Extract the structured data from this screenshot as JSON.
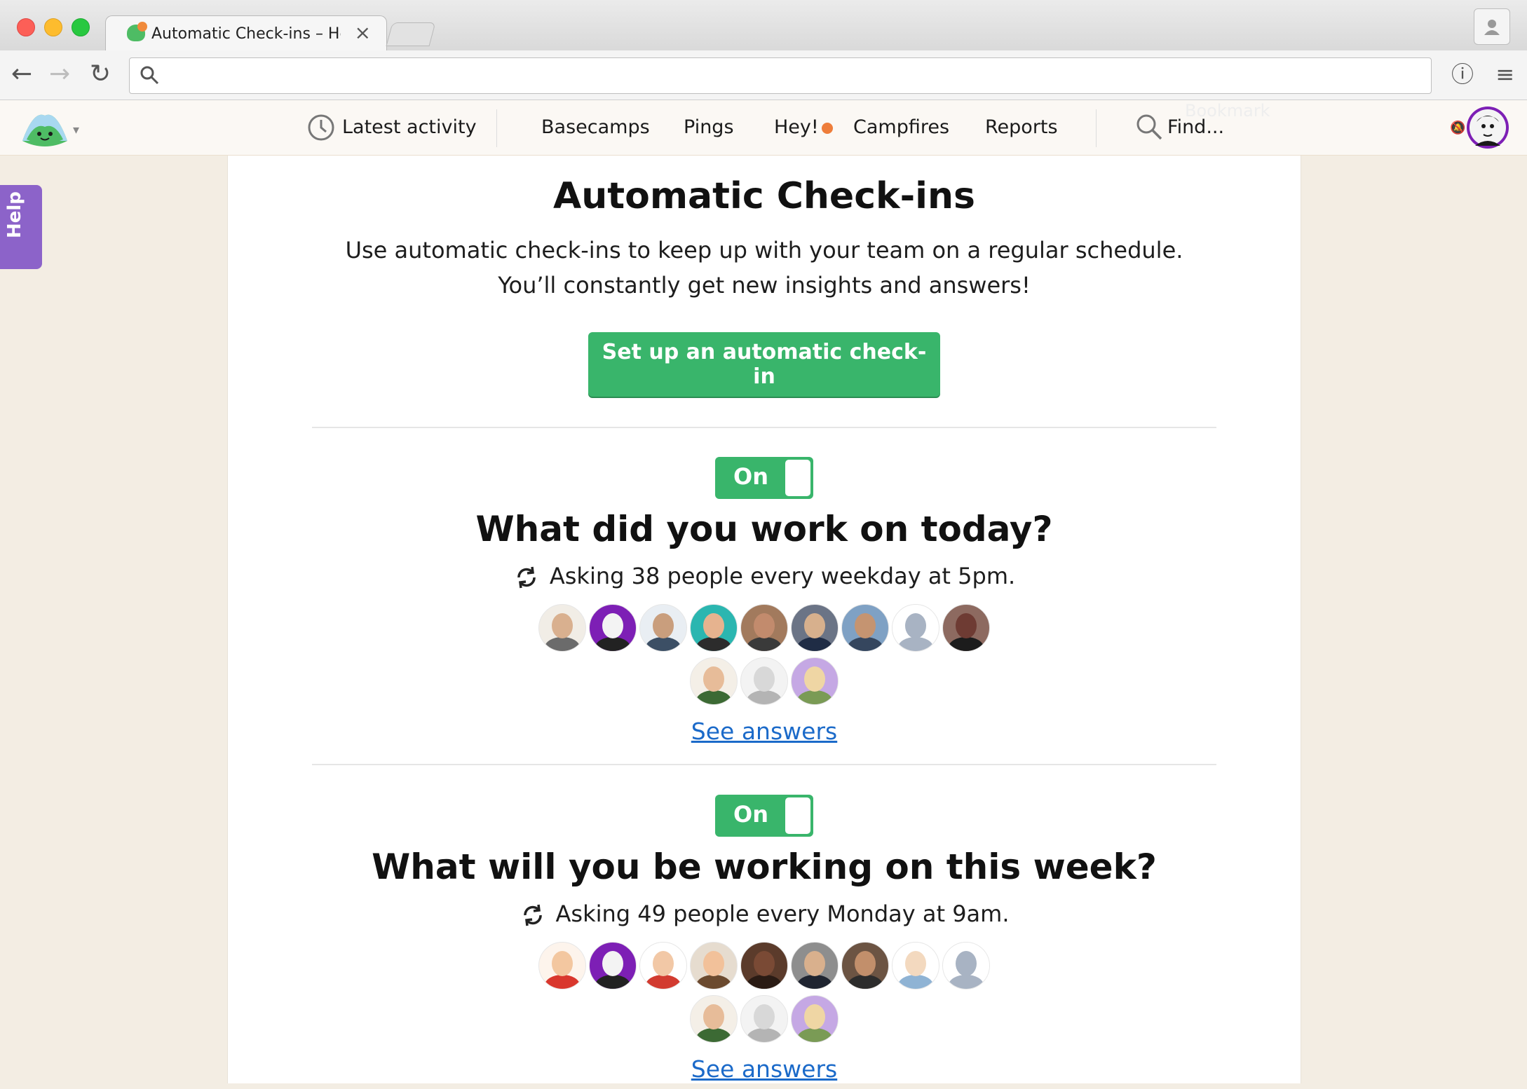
{
  "browser": {
    "tab_title": "Automatic Check-ins – Hea",
    "tab_close": "×",
    "address": ""
  },
  "app_nav": {
    "latest_activity": "Latest activity",
    "basecamps": "Basecamps",
    "pings": "Pings",
    "hey": "Hey!",
    "campfires": "Campfires",
    "reports": "Reports",
    "find": "Find...",
    "ghost_hint": "Bookmark",
    "hey_dot_color": "#ee7d3a"
  },
  "help": {
    "label": "Help"
  },
  "page": {
    "title": "Automatic Check-ins",
    "intro": "Use automatic check-ins to keep up with your team on a regular schedule. You’ll constantly get new insights and answers!",
    "cta": "Set up an automatic check-in"
  },
  "questions": [
    {
      "toggle": "On",
      "title": "What did you work on today?",
      "schedule": "Asking 38 people every weekday at 5pm.",
      "see_answers": "See answers",
      "avatars_row1": [
        {
          "face": "#d9b08f",
          "body": "#6b6b6b",
          "bg": "#f1ede6"
        },
        {
          "face": "#f3f3f3",
          "body": "#222",
          "bg": "#7d1fb5"
        },
        {
          "face": "#c99e7d",
          "body": "#3c4f65",
          "bg": "#e9eef3"
        },
        {
          "face": "#e6b38f",
          "body": "#2c2c2c",
          "bg": "#2bb6b0"
        },
        {
          "face": "#c28b6d",
          "body": "#3a3a3a",
          "bg": "#a27a5d"
        },
        {
          "face": "#d7b08d",
          "body": "#1f2c45",
          "bg": "#6b7486"
        },
        {
          "face": "#c59471",
          "body": "#35465e",
          "bg": "#7fa1c4"
        },
        {
          "face": "#a8b3c3",
          "body": "#a8b3c3",
          "bg": "#ffffff"
        },
        {
          "face": "#6e3b33",
          "body": "#1c1c1c",
          "bg": "#8d6a60"
        }
      ],
      "avatars_row2": [
        {
          "face": "#e7bc99",
          "body": "#3c6a34",
          "bg": "#f4efe7"
        },
        {
          "face": "#d8d8d8",
          "body": "#b4b4b4",
          "bg": "#f3f3f3"
        },
        {
          "face": "#efd6a4",
          "body": "#7a9b55",
          "bg": "#c5a8e4"
        }
      ]
    },
    {
      "toggle": "On",
      "title": "What will you be working on this week?",
      "schedule": "Asking 49 people every Monday at 9am.",
      "see_answers": "See answers",
      "avatars_row1": [
        {
          "face": "#f3c7a0",
          "body": "#d9372d",
          "bg": "#fdf4ec"
        },
        {
          "face": "#f3f3f3",
          "body": "#222",
          "bg": "#7d1fb5"
        },
        {
          "face": "#f2c8a6",
          "body": "#d23b30",
          "bg": "#ffffff"
        },
        {
          "face": "#f2c19a",
          "body": "#6b4a2f",
          "bg": "#e6dccf"
        },
        {
          "face": "#7a4a35",
          "body": "#2a1b14",
          "bg": "#5b3b2b"
        },
        {
          "face": "#d9b08d",
          "body": "#1f2430",
          "bg": "#8e8e8e"
        },
        {
          "face": "#c28f6b",
          "body": "#2c2c2c",
          "bg": "#6c5443"
        },
        {
          "face": "#f3d9bf",
          "body": "#8fb3d4",
          "bg": "#ffffff"
        },
        {
          "face": "#a8b3c3",
          "body": "#a8b3c3",
          "bg": "#ffffff"
        }
      ],
      "avatars_row2": [
        {
          "face": "#e7bc99",
          "body": "#3c6a34",
          "bg": "#f4efe7"
        },
        {
          "face": "#d8d8d8",
          "body": "#b4b4b4",
          "bg": "#f3f3f3"
        },
        {
          "face": "#efd6a4",
          "body": "#7a9b55",
          "bg": "#c5a8e4"
        }
      ]
    }
  ],
  "colors": {
    "brand_green": "#39b56b",
    "link_blue": "#1b6ac9",
    "help_purple": "#8c63c9"
  }
}
